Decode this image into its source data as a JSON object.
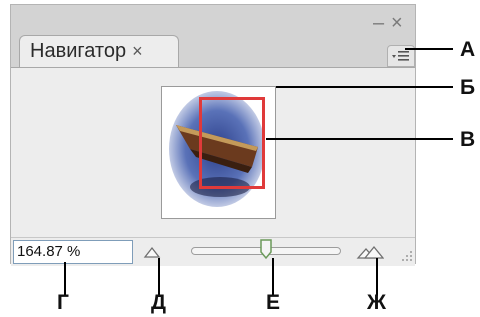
{
  "panel": {
    "tab_label": "Навигатор",
    "tab_close_glyph": "×",
    "minimize_glyph": "–",
    "close_glyph": "×",
    "menu_icon": "panel-menu-icon",
    "zoom_value": "164.87 %",
    "zoom_slider_fraction": 0.5,
    "accent_view_rect": "#e03a3a"
  },
  "callouts": {
    "a": "А",
    "b": "Б",
    "v": "В",
    "g": "Г",
    "d": "Д",
    "e": "Е",
    "zh": "Ж"
  }
}
